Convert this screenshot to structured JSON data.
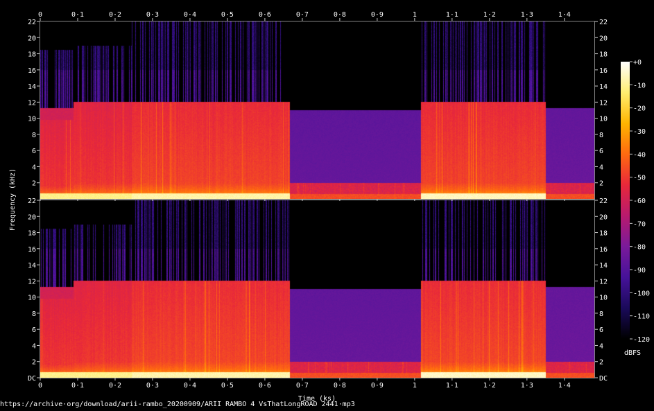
{
  "chart_data": {
    "type": "heatmap",
    "kind": "spectrogram",
    "channels": 2,
    "xlabel": "Time (ks)",
    "ylabel": "Frequency (kHz)",
    "x_range": [
      0,
      1.48
    ],
    "y_range": [
      0,
      22
    ],
    "x_ticks": [
      {
        "v": 0,
        "t": "0"
      },
      {
        "v": 0.1,
        "t": "0·1"
      },
      {
        "v": 0.2,
        "t": "0·2"
      },
      {
        "v": 0.3,
        "t": "0·3"
      },
      {
        "v": 0.4,
        "t": "0·4"
      },
      {
        "v": 0.5,
        "t": "0·5"
      },
      {
        "v": 0.6,
        "t": "0·6"
      },
      {
        "v": 0.7,
        "t": "0·7"
      },
      {
        "v": 0.8,
        "t": "0·8"
      },
      {
        "v": 0.9,
        "t": "0·9"
      },
      {
        "v": 1.0,
        "t": "1"
      },
      {
        "v": 1.1,
        "t": "1·1"
      },
      {
        "v": 1.2,
        "t": "1·2"
      },
      {
        "v": 1.3,
        "t": "1·3"
      },
      {
        "v": 1.4,
        "t": "1·4"
      }
    ],
    "y_ticks_top": [
      {
        "v": 2,
        "t": "2"
      },
      {
        "v": 4,
        "t": "4"
      },
      {
        "v": 6,
        "t": "6"
      },
      {
        "v": 8,
        "t": "8"
      },
      {
        "v": 10,
        "t": "10"
      },
      {
        "v": 12,
        "t": "12"
      },
      {
        "v": 14,
        "t": "14"
      },
      {
        "v": 16,
        "t": "16"
      },
      {
        "v": 18,
        "t": "18"
      },
      {
        "v": 20,
        "t": "20"
      },
      {
        "v": 22,
        "t": "22"
      }
    ],
    "y_ticks_bottom": [
      {
        "v": 0,
        "t": "DC"
      },
      {
        "v": 2,
        "t": "2"
      },
      {
        "v": 4,
        "t": "4"
      },
      {
        "v": 6,
        "t": "6"
      },
      {
        "v": 8,
        "t": "8"
      },
      {
        "v": 10,
        "t": "10"
      },
      {
        "v": 12,
        "t": "12"
      },
      {
        "v": 14,
        "t": "14"
      },
      {
        "v": 16,
        "t": "16"
      },
      {
        "v": 18,
        "t": "18"
      },
      {
        "v": 20,
        "t": "20"
      },
      {
        "v": 22,
        "t": "22"
      }
    ],
    "colorbar": {
      "label": "dBFS",
      "range": [
        -120,
        0
      ],
      "ticks": [
        {
          "v": 0,
          "t": "+0"
        },
        {
          "v": -10,
          "t": "-10"
        },
        {
          "v": -20,
          "t": "-20"
        },
        {
          "v": -30,
          "t": "-30"
        },
        {
          "v": -40,
          "t": "-40"
        },
        {
          "v": -50,
          "t": "-50"
        },
        {
          "v": -60,
          "t": "-60"
        },
        {
          "v": -70,
          "t": "-70"
        },
        {
          "v": -80,
          "t": "-80"
        },
        {
          "v": -90,
          "t": "-90"
        },
        {
          "v": -100,
          "t": "-100"
        },
        {
          "v": -110,
          "t": "-110"
        },
        {
          "v": -120,
          "t": "-120"
        }
      ],
      "stops": [
        "#000000",
        "#1a0a5a",
        "#46129a",
        "#7a1a9a",
        "#b81a6e",
        "#e8283a",
        "#ff6a10",
        "#ffb400",
        "#ffee70",
        "#ffffff"
      ]
    },
    "segments": [
      {
        "t0": 0.0,
        "t1": 0.089,
        "cutoff_khz": 9.8,
        "upper_band_khz": 11.3,
        "body_db": -50,
        "low_db": -25,
        "sparkle_khz": 18.5
      },
      {
        "t0": 0.089,
        "t1": 0.244,
        "cutoff_khz": 12.0,
        "upper_band_khz": 0,
        "body_db": -50,
        "low_db": -25,
        "sparkle_khz": 19.0
      },
      {
        "t0": 0.244,
        "t1": 0.667,
        "cutoff_khz": 12.0,
        "upper_band_khz": 0,
        "body_db": -47,
        "low_db": -22,
        "sparkle_khz": 22
      },
      {
        "t0": 0.667,
        "t1": 1.017,
        "cutoff_khz": 0,
        "upper_band_khz": 11.0,
        "body_db": -85,
        "low_db": -55,
        "sparkle_khz": 0
      },
      {
        "t0": 1.017,
        "t1": 1.35,
        "cutoff_khz": 12.0,
        "upper_band_khz": 0,
        "body_db": -47,
        "low_db": -20,
        "sparkle_khz": 22
      },
      {
        "t0": 1.35,
        "t1": 1.48,
        "cutoff_khz": 0,
        "upper_band_khz": 11.3,
        "body_db": -84,
        "low_db": -55,
        "sparkle_khz": 0
      }
    ]
  },
  "footer": {
    "source": "https://archive·org/download/arii-rambo_20200909/ARII RAMBO 4 VsThatLongROAD  2441·mp3"
  }
}
